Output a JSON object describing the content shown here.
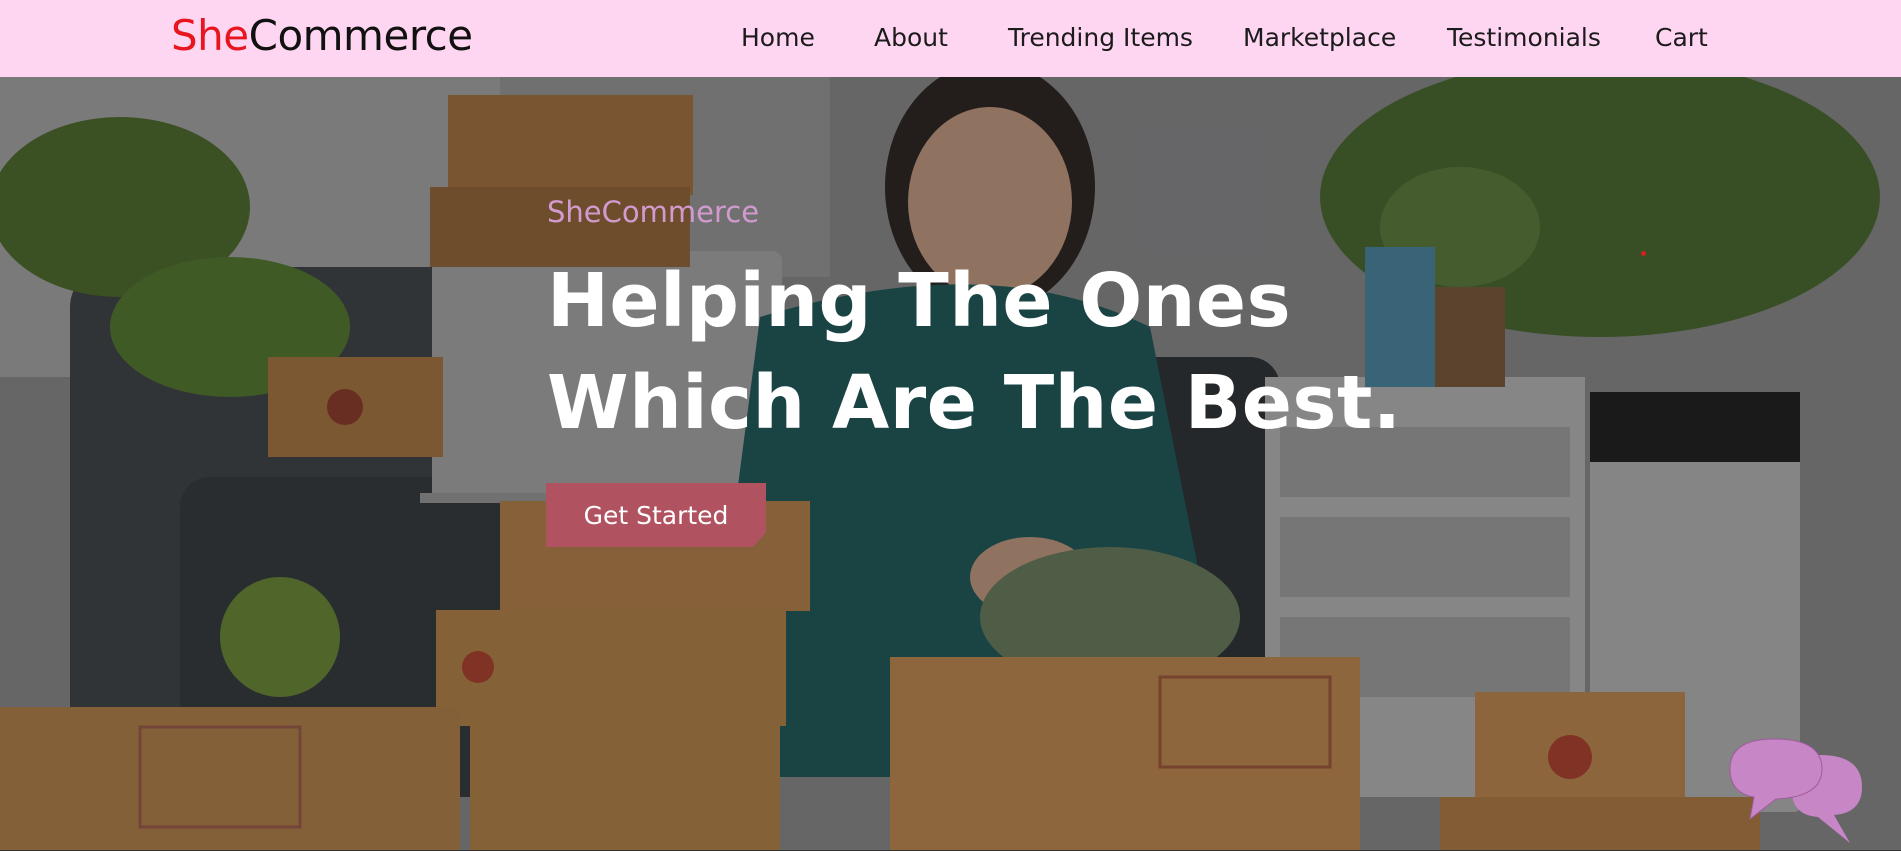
{
  "brand": {
    "name_accent": "She",
    "name_rest": "Commerce",
    "accent_color": "#e8141e"
  },
  "nav": {
    "items": [
      {
        "label": "Home"
      },
      {
        "label": "About"
      },
      {
        "label": "Trending Items"
      },
      {
        "label": "Marketplace"
      },
      {
        "label": "Testimonials"
      },
      {
        "label": "Cart"
      }
    ]
  },
  "hero": {
    "kicker": "SheCommerce",
    "title": "Helping The Ones Which Are The Best.",
    "cta_label": "Get Started",
    "kicker_color": "#d39ad0",
    "cta_color": "#b0525f"
  },
  "chat_widget": {
    "icon": "chat-bubbles-icon",
    "color": "#c786c6"
  },
  "colors": {
    "navbar_bg": "#ffd6f1"
  }
}
